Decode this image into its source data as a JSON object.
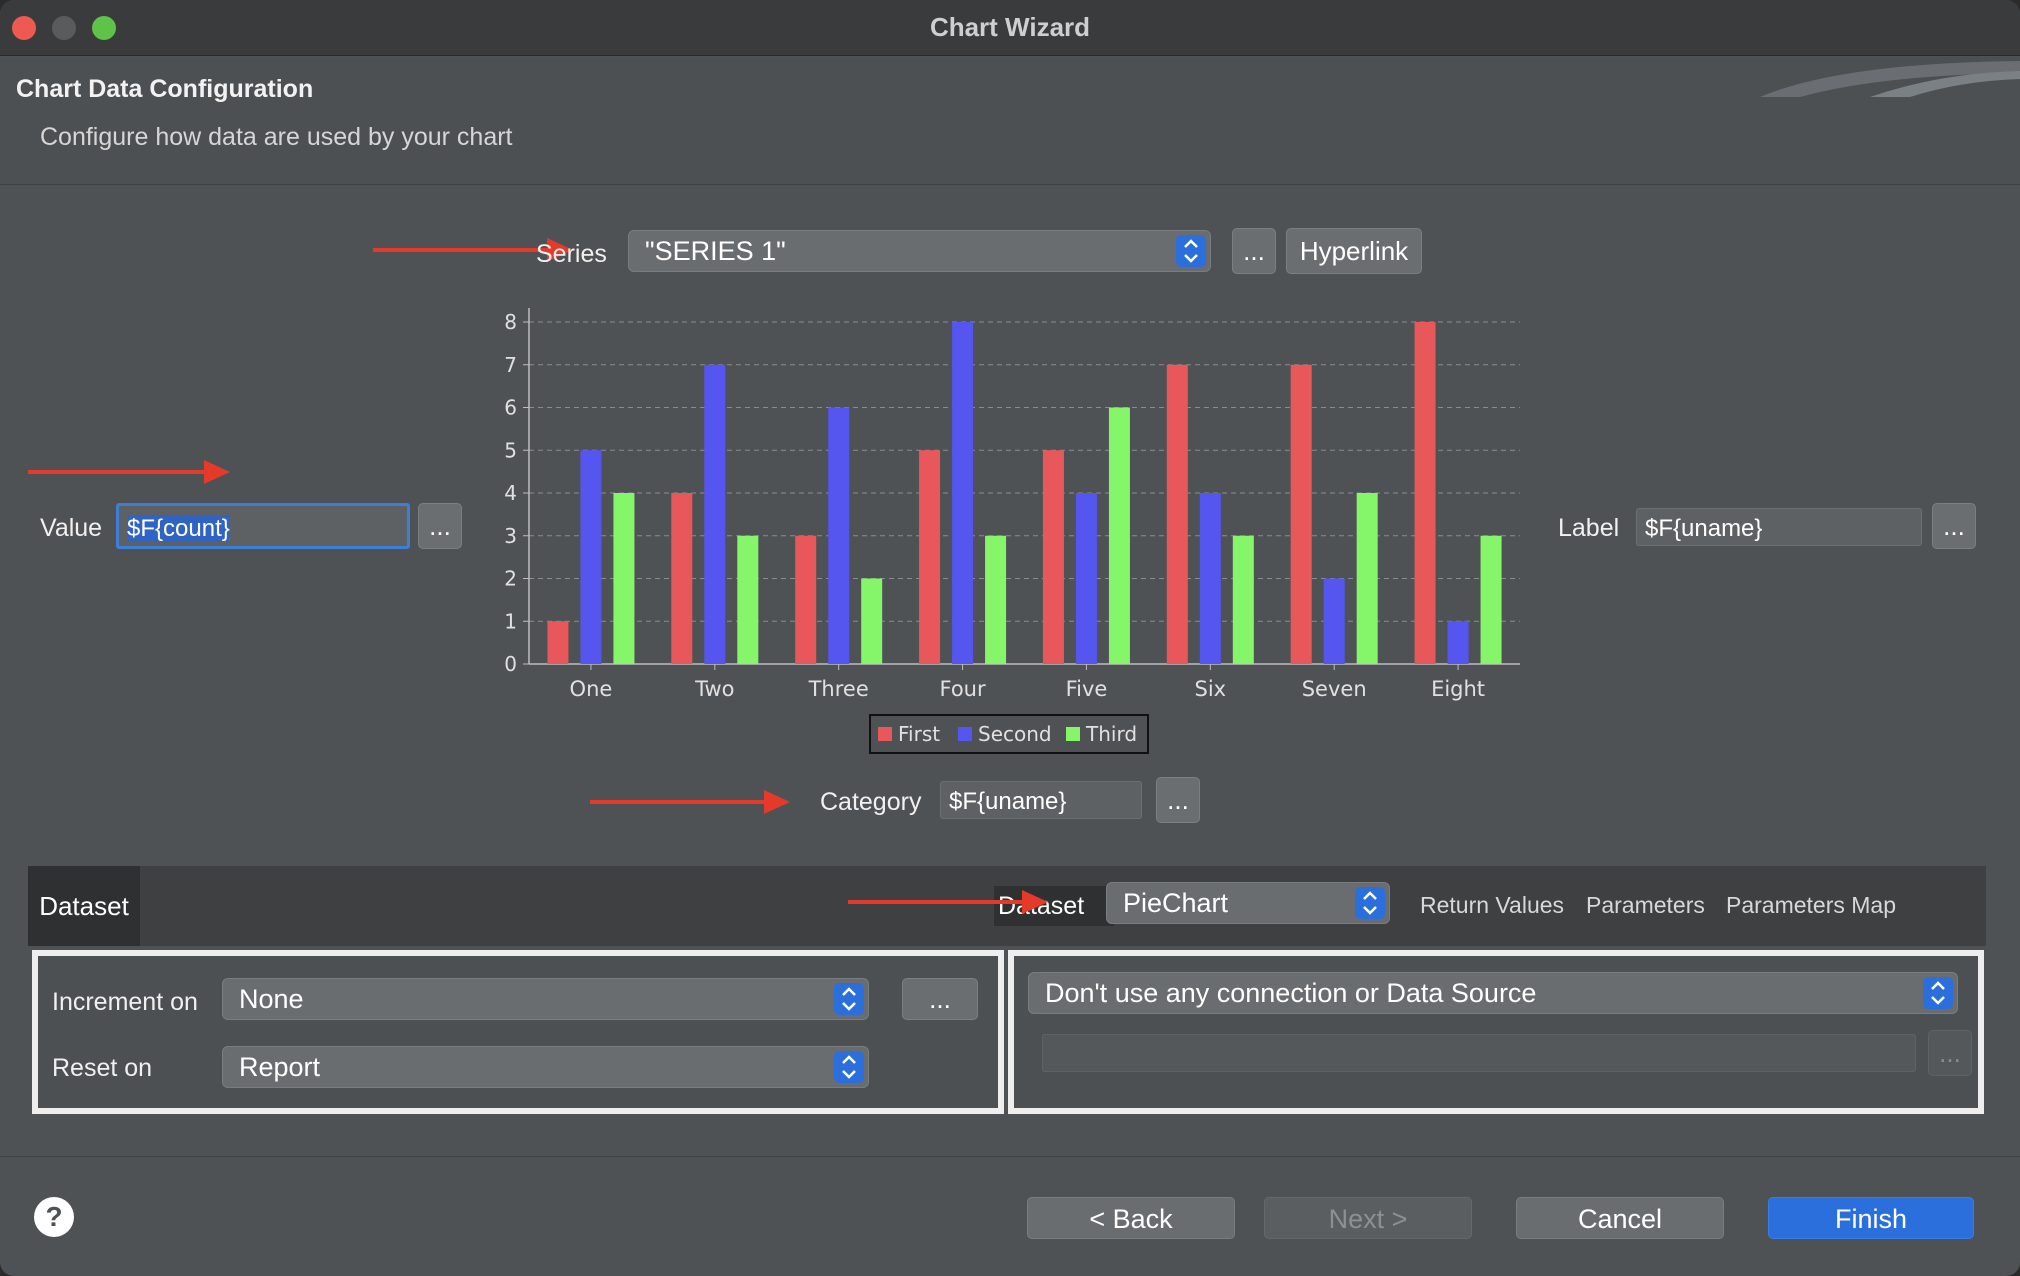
{
  "window": {
    "title": "Chart Wizard"
  },
  "header": {
    "title": "Chart Data Configuration",
    "subtitle": "Configure how data are used by your chart"
  },
  "series": {
    "label": "Series",
    "value": "\"SERIES 1\"",
    "more_label": "...",
    "hyperlink_label": "Hyperlink"
  },
  "value_field": {
    "label": "Value",
    "value": "$F{count}",
    "more_label": "..."
  },
  "label_field": {
    "label": "Label",
    "value": "$F{uname}",
    "more_label": "..."
  },
  "category_field": {
    "label": "Category",
    "value": "$F{uname}",
    "more_label": "..."
  },
  "chart_data": {
    "type": "bar",
    "categories": [
      "One",
      "Two",
      "Three",
      "Four",
      "Five",
      "Six",
      "Seven",
      "Eight"
    ],
    "series": [
      {
        "name": "First",
        "color": "#e8585a",
        "values": [
          1,
          4,
          3,
          5,
          5,
          7,
          7,
          8
        ]
      },
      {
        "name": "Second",
        "color": "#5555f0",
        "values": [
          5,
          7,
          6,
          8,
          4,
          4,
          2,
          1
        ]
      },
      {
        "name": "Third",
        "color": "#85f56a",
        "values": [
          4,
          3,
          2,
          3,
          6,
          3,
          4,
          3
        ]
      }
    ],
    "y_ticks": [
      "0",
      "1",
      "2",
      "3",
      "4",
      "5",
      "6",
      "7",
      "8"
    ],
    "ylim": [
      0,
      8
    ],
    "grid": true,
    "legend": "bottom"
  },
  "tabs": {
    "dataset_tab": "Dataset",
    "dataset_label": "Dataset",
    "dataset_value": "PieChart",
    "return_values": "Return Values",
    "parameters": "Parameters",
    "parameters_map": "Parameters Map"
  },
  "left_panel": {
    "increment_label": "Increment on",
    "increment_value": "None",
    "more_label": "...",
    "reset_label": "Reset on",
    "reset_value": "Report"
  },
  "right_panel": {
    "connection_value": "Don't use any connection or Data Source",
    "more_label": "..."
  },
  "footer": {
    "help_label": "?",
    "back_label": "< Back",
    "next_label": "Next >",
    "cancel_label": "Cancel",
    "finish_label": "Finish"
  },
  "colors": {
    "accent": "#2b6fdc",
    "annotation_arrow": "#e53a2a"
  }
}
